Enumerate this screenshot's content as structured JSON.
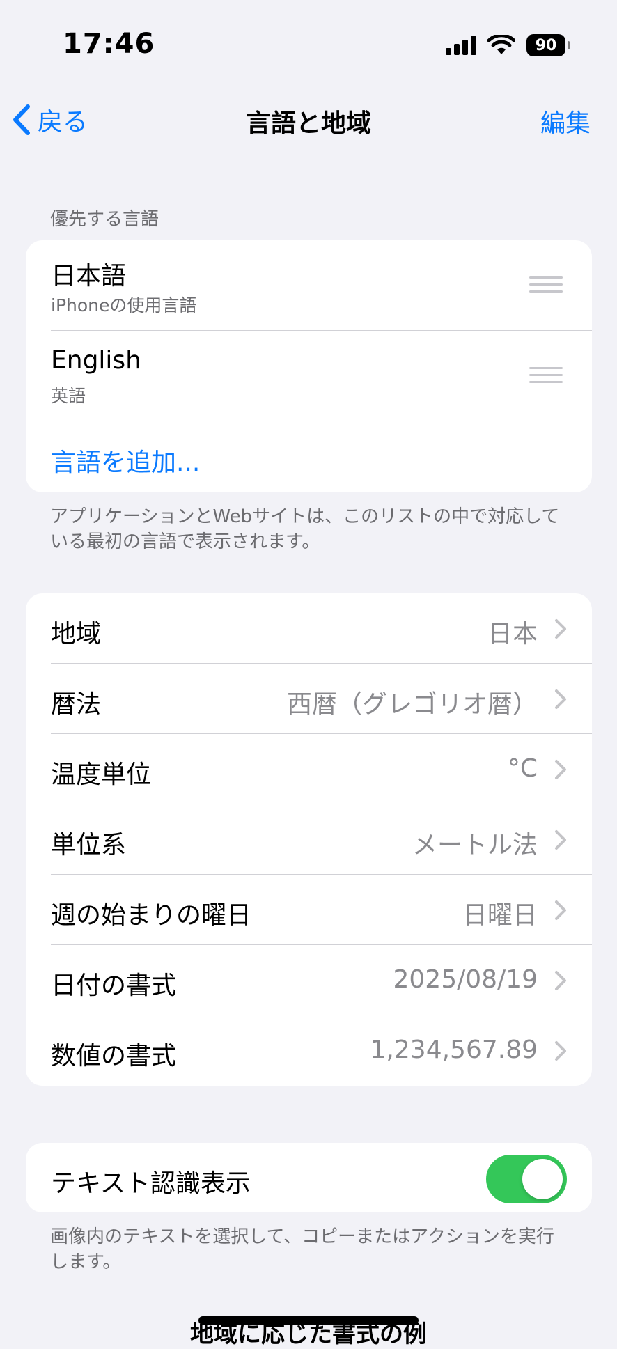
{
  "status": {
    "time": "17:46",
    "battery": "90"
  },
  "nav": {
    "back_label": "戻る",
    "title": "言語と地域",
    "edit_label": "編集"
  },
  "languages": {
    "header": "優先する言語",
    "items": [
      {
        "name": "日本語",
        "subtitle": "iPhoneの使用言語"
      },
      {
        "name": "English",
        "subtitle": "英語"
      }
    ],
    "add_label": "言語を追加...",
    "footer": "アプリケーションとWebサイトは、このリストの中で対応している最初の言語で表示されます。"
  },
  "settings": [
    {
      "label": "地域",
      "value": "日本"
    },
    {
      "label": "暦法",
      "value": "西暦（グレゴリオ暦）"
    },
    {
      "label": "温度単位",
      "value": "°C"
    },
    {
      "label": "単位系",
      "value": "メートル法"
    },
    {
      "label": "週の始まりの曜日",
      "value": "日曜日"
    },
    {
      "label": "日付の書式",
      "value": "2025/08/19"
    },
    {
      "label": "数値の書式",
      "value": "1,234,567.89"
    }
  ],
  "live_text": {
    "label": "テキスト認識表示",
    "enabled": true,
    "footer": "画像内のテキストを選択して、コピーまたはアクションを実行します。"
  },
  "bottom_title": "地域に応じた書式の例",
  "colors": {
    "accent": "#0a7aff",
    "toggle_on": "#34c759",
    "background": "#f2f2f7"
  }
}
